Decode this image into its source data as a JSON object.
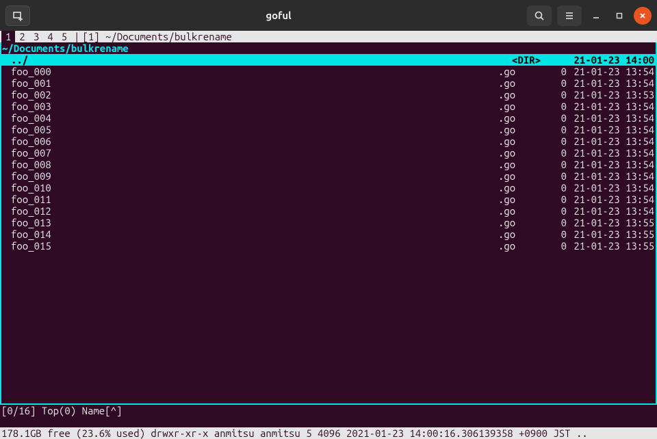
{
  "titlebar": {
    "title": "goful"
  },
  "tabbar": {
    "tabs": [
      "1",
      "2",
      "3",
      "4",
      "5"
    ],
    "active": 0,
    "separator": "|",
    "panel_label": "[1] ~/Documents/bulkrename"
  },
  "path": "~/Documents/bulkrename",
  "parent_row": {
    "name": "../",
    "dir_label": "<DIR>",
    "date": "21-01-23 14:00"
  },
  "files": [
    {
      "name": "foo_000",
      "ext": ".go",
      "size": "0",
      "date": "21-01-23 13:54"
    },
    {
      "name": "foo_001",
      "ext": ".go",
      "size": "0",
      "date": "21-01-23 13:54"
    },
    {
      "name": "foo_002",
      "ext": ".go",
      "size": "0",
      "date": "21-01-23 13:53"
    },
    {
      "name": "foo_003",
      "ext": ".go",
      "size": "0",
      "date": "21-01-23 13:54"
    },
    {
      "name": "foo_004",
      "ext": ".go",
      "size": "0",
      "date": "21-01-23 13:54"
    },
    {
      "name": "foo_005",
      "ext": ".go",
      "size": "0",
      "date": "21-01-23 13:54"
    },
    {
      "name": "foo_006",
      "ext": ".go",
      "size": "0",
      "date": "21-01-23 13:54"
    },
    {
      "name": "foo_007",
      "ext": ".go",
      "size": "0",
      "date": "21-01-23 13:54"
    },
    {
      "name": "foo_008",
      "ext": ".go",
      "size": "0",
      "date": "21-01-23 13:54"
    },
    {
      "name": "foo_009",
      "ext": ".go",
      "size": "0",
      "date": "21-01-23 13:54"
    },
    {
      "name": "foo_010",
      "ext": ".go",
      "size": "0",
      "date": "21-01-23 13:54"
    },
    {
      "name": "foo_011",
      "ext": ".go",
      "size": "0",
      "date": "21-01-23 13:54"
    },
    {
      "name": "foo_012",
      "ext": ".go",
      "size": "0",
      "date": "21-01-23 13:54"
    },
    {
      "name": "foo_013",
      "ext": ".go",
      "size": "0",
      "date": "21-01-23 13:55"
    },
    {
      "name": "foo_014",
      "ext": ".go",
      "size": "0",
      "date": "21-01-23 13:55"
    },
    {
      "name": "foo_015",
      "ext": ".go",
      "size": "0",
      "date": "21-01-23 13:55"
    }
  ],
  "status1": "[0/16] Top(0) Name[^]",
  "status2": "178.1GB free (23.6% used) drwxr-xr-x anmitsu anmitsu 5 4096 2021-01-23 14:00:16.306139358 +0900 JST .."
}
